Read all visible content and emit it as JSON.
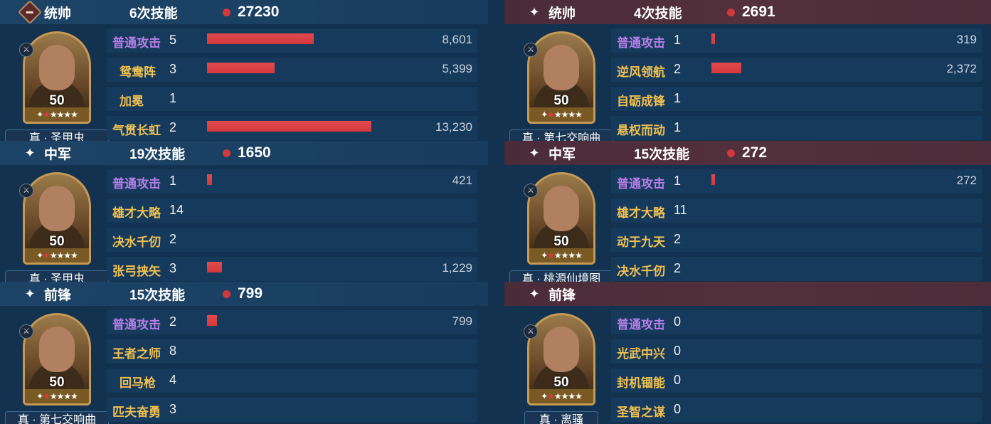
{
  "left": {
    "units": [
      {
        "role": "统帅",
        "role_icon": "commander-badge-icon",
        "skill_uses": "6次技能",
        "damage_total": "27230",
        "level": "50",
        "tag": "真 · 圣甲虫",
        "skills": [
          {
            "name": "普通攻击",
            "count": "5",
            "damage": "8,601",
            "bar_ratio": 0.65,
            "basic": true
          },
          {
            "name": "鸳鸯阵",
            "count": "3",
            "damage": "5,399",
            "bar_ratio": 0.41,
            "basic": false
          },
          {
            "name": "加冕",
            "count": "1",
            "damage": "",
            "bar_ratio": 0,
            "basic": false
          },
          {
            "name": "气贯长虹",
            "count": "2",
            "damage": "13,230",
            "bar_ratio": 1.0,
            "basic": false
          }
        ]
      },
      {
        "role": "中军",
        "role_icon": "sparkle-icon",
        "skill_uses": "19次技能",
        "damage_total": "1650",
        "level": "50",
        "tag": "真 · 圣甲虫",
        "skills": [
          {
            "name": "普通攻击",
            "count": "1",
            "damage": "421",
            "bar_ratio": 0.03,
            "basic": true
          },
          {
            "name": "雄才大略",
            "count": "14",
            "damage": "",
            "bar_ratio": 0,
            "basic": false
          },
          {
            "name": "决水千仞",
            "count": "2",
            "damage": "",
            "bar_ratio": 0,
            "basic": false
          },
          {
            "name": "张弓挟矢",
            "count": "3",
            "damage": "1,229",
            "bar_ratio": 0.09,
            "basic": false
          }
        ]
      },
      {
        "role": "前锋",
        "role_icon": "sparkle-icon",
        "skill_uses": "15次技能",
        "damage_total": "799",
        "level": "50",
        "tag": "真 · 第七交响曲",
        "skills": [
          {
            "name": "普通攻击",
            "count": "2",
            "damage": "799",
            "bar_ratio": 0.06,
            "basic": true
          },
          {
            "name": "王者之师",
            "count": "8",
            "damage": "",
            "bar_ratio": 0,
            "basic": false
          },
          {
            "name": "回马枪",
            "count": "4",
            "damage": "",
            "bar_ratio": 0,
            "basic": false
          },
          {
            "name": "匹夫奋勇",
            "count": "3",
            "damage": "",
            "bar_ratio": 0,
            "basic": false
          }
        ]
      }
    ]
  },
  "right": {
    "units": [
      {
        "role": "统帅",
        "role_icon": "sparkle-icon",
        "skill_uses": "4次技能",
        "damage_total": "2691",
        "level": "50",
        "tag": "真 · 第七交响曲",
        "skills": [
          {
            "name": "普通攻击",
            "count": "1",
            "damage": "319",
            "bar_ratio": 0.02,
            "basic": true
          },
          {
            "name": "逆风领航",
            "count": "2",
            "damage": "2,372",
            "bar_ratio": 0.18,
            "basic": false
          },
          {
            "name": "自砺成锋",
            "count": "1",
            "damage": "",
            "bar_ratio": 0,
            "basic": false
          },
          {
            "name": "悬权而动",
            "count": "1",
            "damage": "",
            "bar_ratio": 0,
            "basic": false
          }
        ]
      },
      {
        "role": "中军",
        "role_icon": "sparkle-icon",
        "skill_uses": "15次技能",
        "damage_total": "272",
        "level": "50",
        "tag": "真 · 桃源仙境图",
        "skills": [
          {
            "name": "普通攻击",
            "count": "1",
            "damage": "272",
            "bar_ratio": 0.02,
            "basic": true
          },
          {
            "name": "雄才大略",
            "count": "11",
            "damage": "",
            "bar_ratio": 0,
            "basic": false
          },
          {
            "name": "动于九天",
            "count": "2",
            "damage": "",
            "bar_ratio": 0,
            "basic": false
          },
          {
            "name": "决水千仞",
            "count": "2",
            "damage": "",
            "bar_ratio": 0,
            "basic": false
          }
        ]
      },
      {
        "role": "前锋",
        "role_icon": "sparkle-icon",
        "skill_uses": "",
        "damage_total": "",
        "level": "50",
        "tag": "真 · 离骚",
        "skills": [
          {
            "name": "普通攻击",
            "count": "0",
            "damage": "",
            "bar_ratio": 0,
            "basic": true
          },
          {
            "name": "光武中兴",
            "count": "0",
            "damage": "",
            "bar_ratio": 0,
            "basic": false
          },
          {
            "name": "封机锢能",
            "count": "0",
            "damage": "",
            "bar_ratio": 0,
            "basic": false
          },
          {
            "name": "圣智之谋",
            "count": "0",
            "damage": "",
            "bar_ratio": 0,
            "basic": false
          }
        ]
      }
    ]
  },
  "colors": {
    "bar": "#d3383c",
    "basic_skill": "#b57ee8",
    "skill": "#f0c050",
    "right_header": "#4d2d39",
    "left_header": "#1c4366"
  },
  "stars": {
    "filled_red": 1,
    "total": 6
  }
}
